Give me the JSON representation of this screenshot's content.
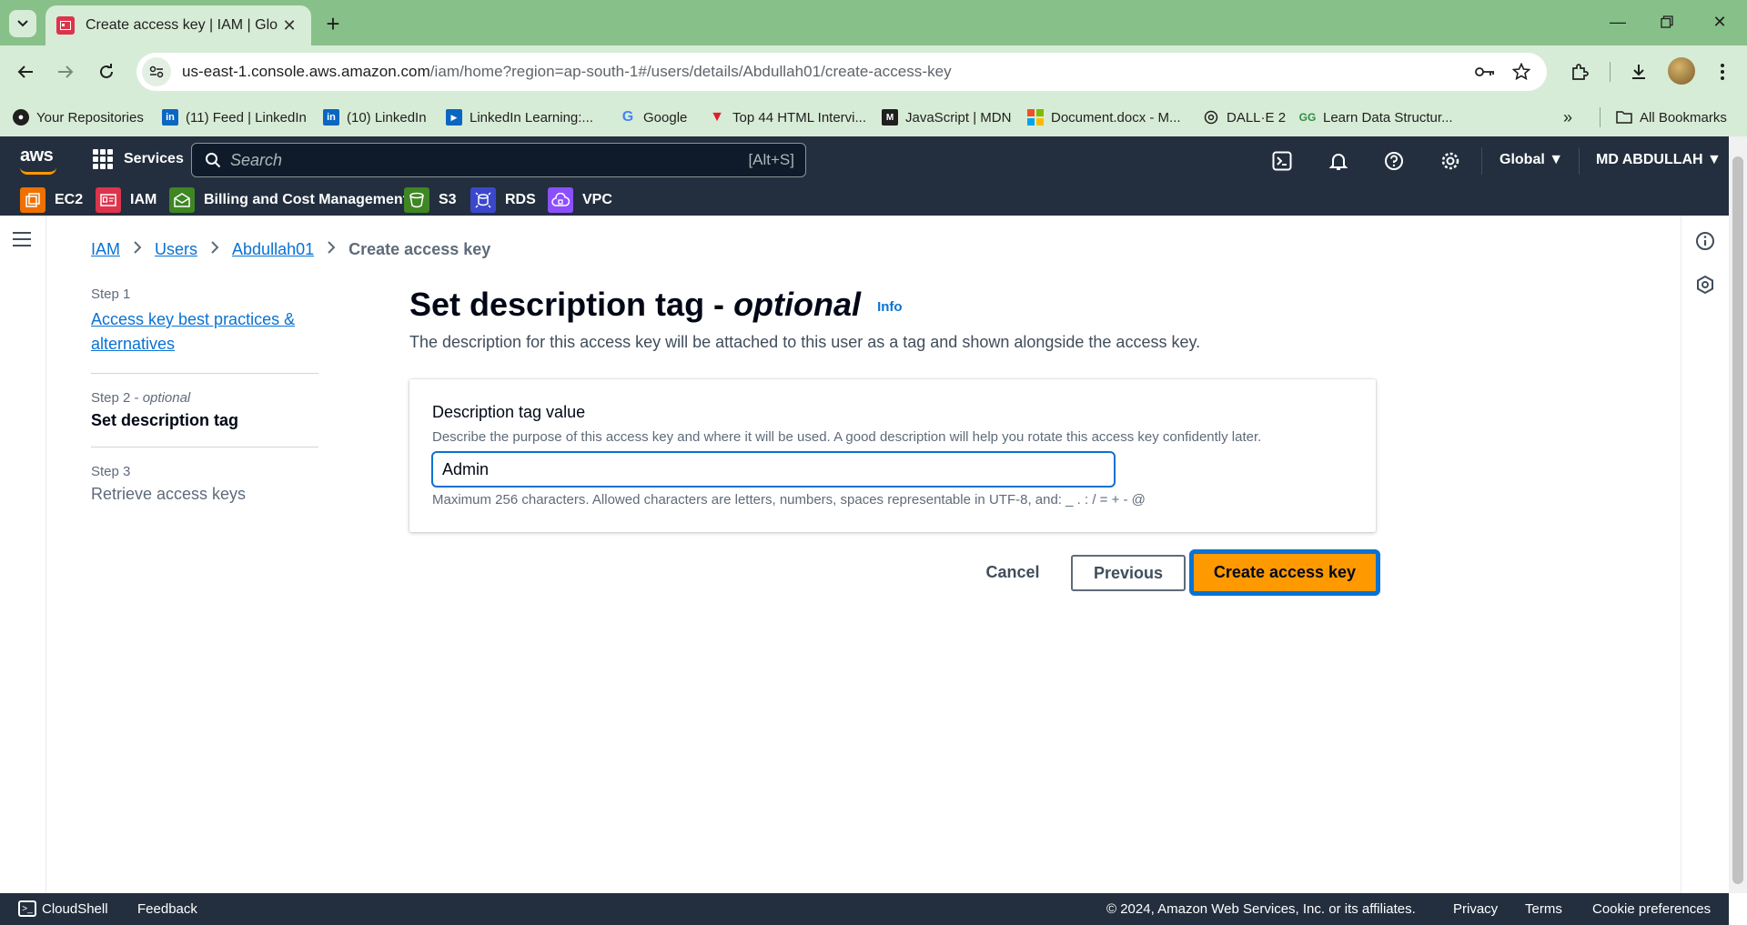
{
  "browser": {
    "tab_title": "Create access key | IAM | Global",
    "url_host": "us-east-1.console.aws.amazon.com",
    "url_path": "/iam/home?region=ap-south-1#/users/details/Abdullah01/create-access-key",
    "bookmarks": [
      {
        "label": "Your Repositories",
        "icon": "github-icon"
      },
      {
        "label": "(11) Feed | LinkedIn",
        "icon": "linkedin-icon"
      },
      {
        "label": "(10) LinkedIn",
        "icon": "linkedin-icon"
      },
      {
        "label": "LinkedIn Learning:...",
        "icon": "linkedin-learning-icon"
      },
      {
        "label": "Google",
        "icon": "google-icon"
      },
      {
        "label": "Top 44 HTML Intervi...",
        "icon": "v-logo-icon"
      },
      {
        "label": "JavaScript | MDN",
        "icon": "mdn-icon"
      },
      {
        "label": "Document.docx - M...",
        "icon": "microsoft-icon"
      },
      {
        "label": "DALL·E 2",
        "icon": "openai-icon"
      },
      {
        "label": "Learn Data Structur...",
        "icon": "gfg-icon"
      }
    ],
    "all_bookmarks": "All Bookmarks"
  },
  "aws": {
    "logo": "aws",
    "services": "Services",
    "search_placeholder": "Search",
    "search_shortcut": "[Alt+S]",
    "region": "Global ▼",
    "user": "MD ABDULLAH ▼",
    "favorites": [
      {
        "label": "EC2",
        "color": "#ed7100"
      },
      {
        "label": "IAM",
        "color": "#dd344c"
      },
      {
        "label": "Billing and Cost Management",
        "color": "#3f8624"
      },
      {
        "label": "S3",
        "color": "#3f8624"
      },
      {
        "label": "RDS",
        "color": "#3b48cc"
      },
      {
        "label": "VPC",
        "color": "#8c4fff"
      }
    ]
  },
  "breadcrumb": {
    "iam": "IAM",
    "users": "Users",
    "user": "Abdullah01",
    "current": "Create access key"
  },
  "steps": {
    "step1_label": "Step 1",
    "step1_title": "Access key best practices & alternatives",
    "step2_label": "Step 2",
    "step2_optional": "optional",
    "step2_title": "Set description tag",
    "step3_label": "Step 3",
    "step3_title": "Retrieve access keys"
  },
  "main": {
    "title": "Set description tag -",
    "title_optional": "optional",
    "info": "Info",
    "description": "The description for this access key will be attached to this user as a tag and shown alongside the access key.",
    "field_label": "Description tag value",
    "field_description": "Describe the purpose of this access key and where it will be used. A good description will help you rotate this access key confidently later.",
    "field_value": "Admin",
    "field_constraint": "Maximum 256 characters. Allowed characters are letters, numbers, spaces representable in UTF-8, and: _ . : / = + - @"
  },
  "actions": {
    "cancel": "Cancel",
    "previous": "Previous",
    "create": "Create access key"
  },
  "footer": {
    "cloudshell": "CloudShell",
    "feedback": "Feedback",
    "copyright": "© 2024, Amazon Web Services, Inc. or its affiliates.",
    "privacy": "Privacy",
    "terms": "Terms",
    "cookie": "Cookie preferences"
  }
}
